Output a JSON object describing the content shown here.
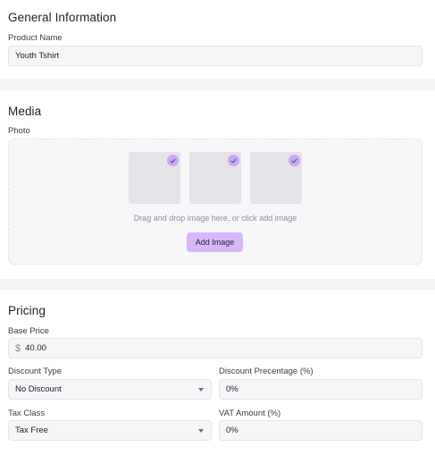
{
  "general": {
    "title": "General Information",
    "product_name_label": "Product Name",
    "product_name_value": "Youth Tshirt"
  },
  "media": {
    "title": "Media",
    "photo_label": "Photo",
    "thumbnails": [
      {
        "icon": "check-icon",
        "selected": true
      },
      {
        "icon": "check-icon",
        "selected": true
      },
      {
        "icon": "check-icon",
        "selected": true
      }
    ],
    "hint": "Drag and drop image here, or click add image",
    "add_button": "Add Image"
  },
  "pricing": {
    "title": "Pricing",
    "base_price_label": "Base Price",
    "currency_symbol": "$",
    "base_price_value": "40.00",
    "discount_type_label": "Discount Type",
    "discount_type_value": "No Discount",
    "discount_percentage_label": "Discount Precentage (%)",
    "discount_percentage_value": "0%",
    "tax_class_label": "Tax Class",
    "tax_class_value": "Tax Free",
    "vat_amount_label": "VAT Amount (%)",
    "vat_amount_value": "0%"
  },
  "colors": {
    "accent": "#d9b6f8",
    "check_badge": "#c9a8f3",
    "input_bg": "#f6f6f8",
    "page_bg": "#f4f4f7"
  }
}
